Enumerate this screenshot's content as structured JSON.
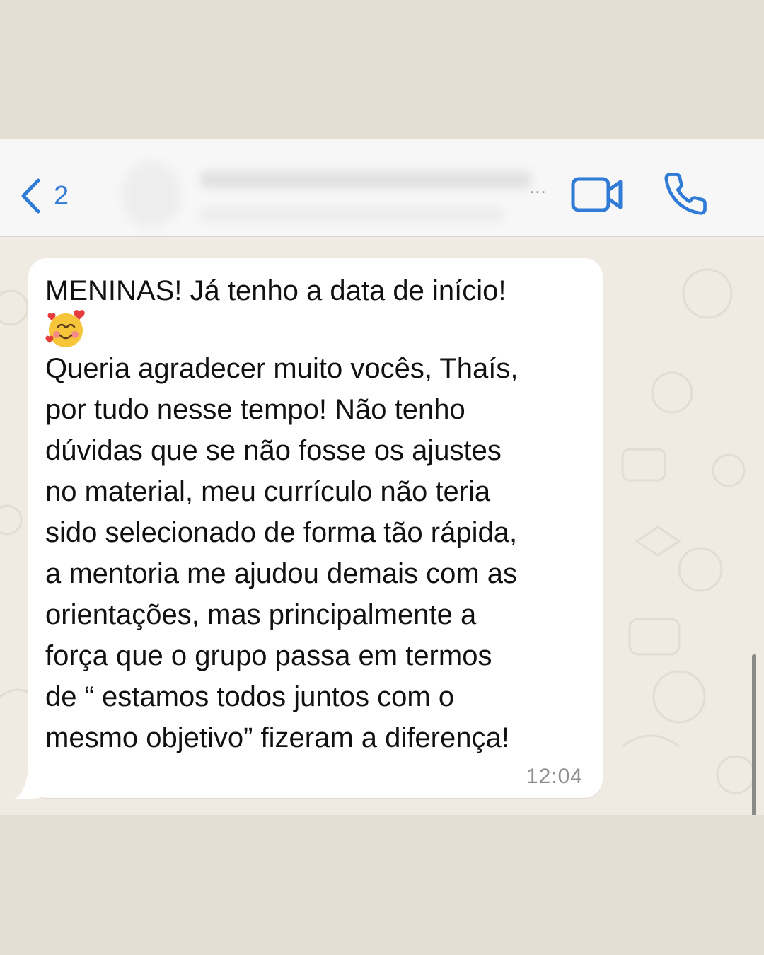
{
  "header": {
    "back_count": "2",
    "contact_more": "..."
  },
  "message": {
    "lines": [
      "MENINAS! Já tenho a data de início!",
      "Queria agradecer muito vocês, Thaís,",
      "por tudo nesse tempo! Não tenho",
      "dúvidas que se não fosse os ajustes",
      "no material, meu currículo não teria",
      "sido selecionado de forma tão rápida,",
      "a mentoria me ajudou demais com as",
      "orientações, mas principalmente a",
      "força que o grupo passa em termos",
      "de “ estamos todos juntos com o",
      "mesmo objetivo” fizeram a diferença!"
    ],
    "emoji": "smiling-face-with-hearts",
    "time": "12:04"
  },
  "colors": {
    "background": "#e3dfd3",
    "accent": "#2f7bd6",
    "chat_background": "#efeae2",
    "bubble": "#ffffff"
  }
}
